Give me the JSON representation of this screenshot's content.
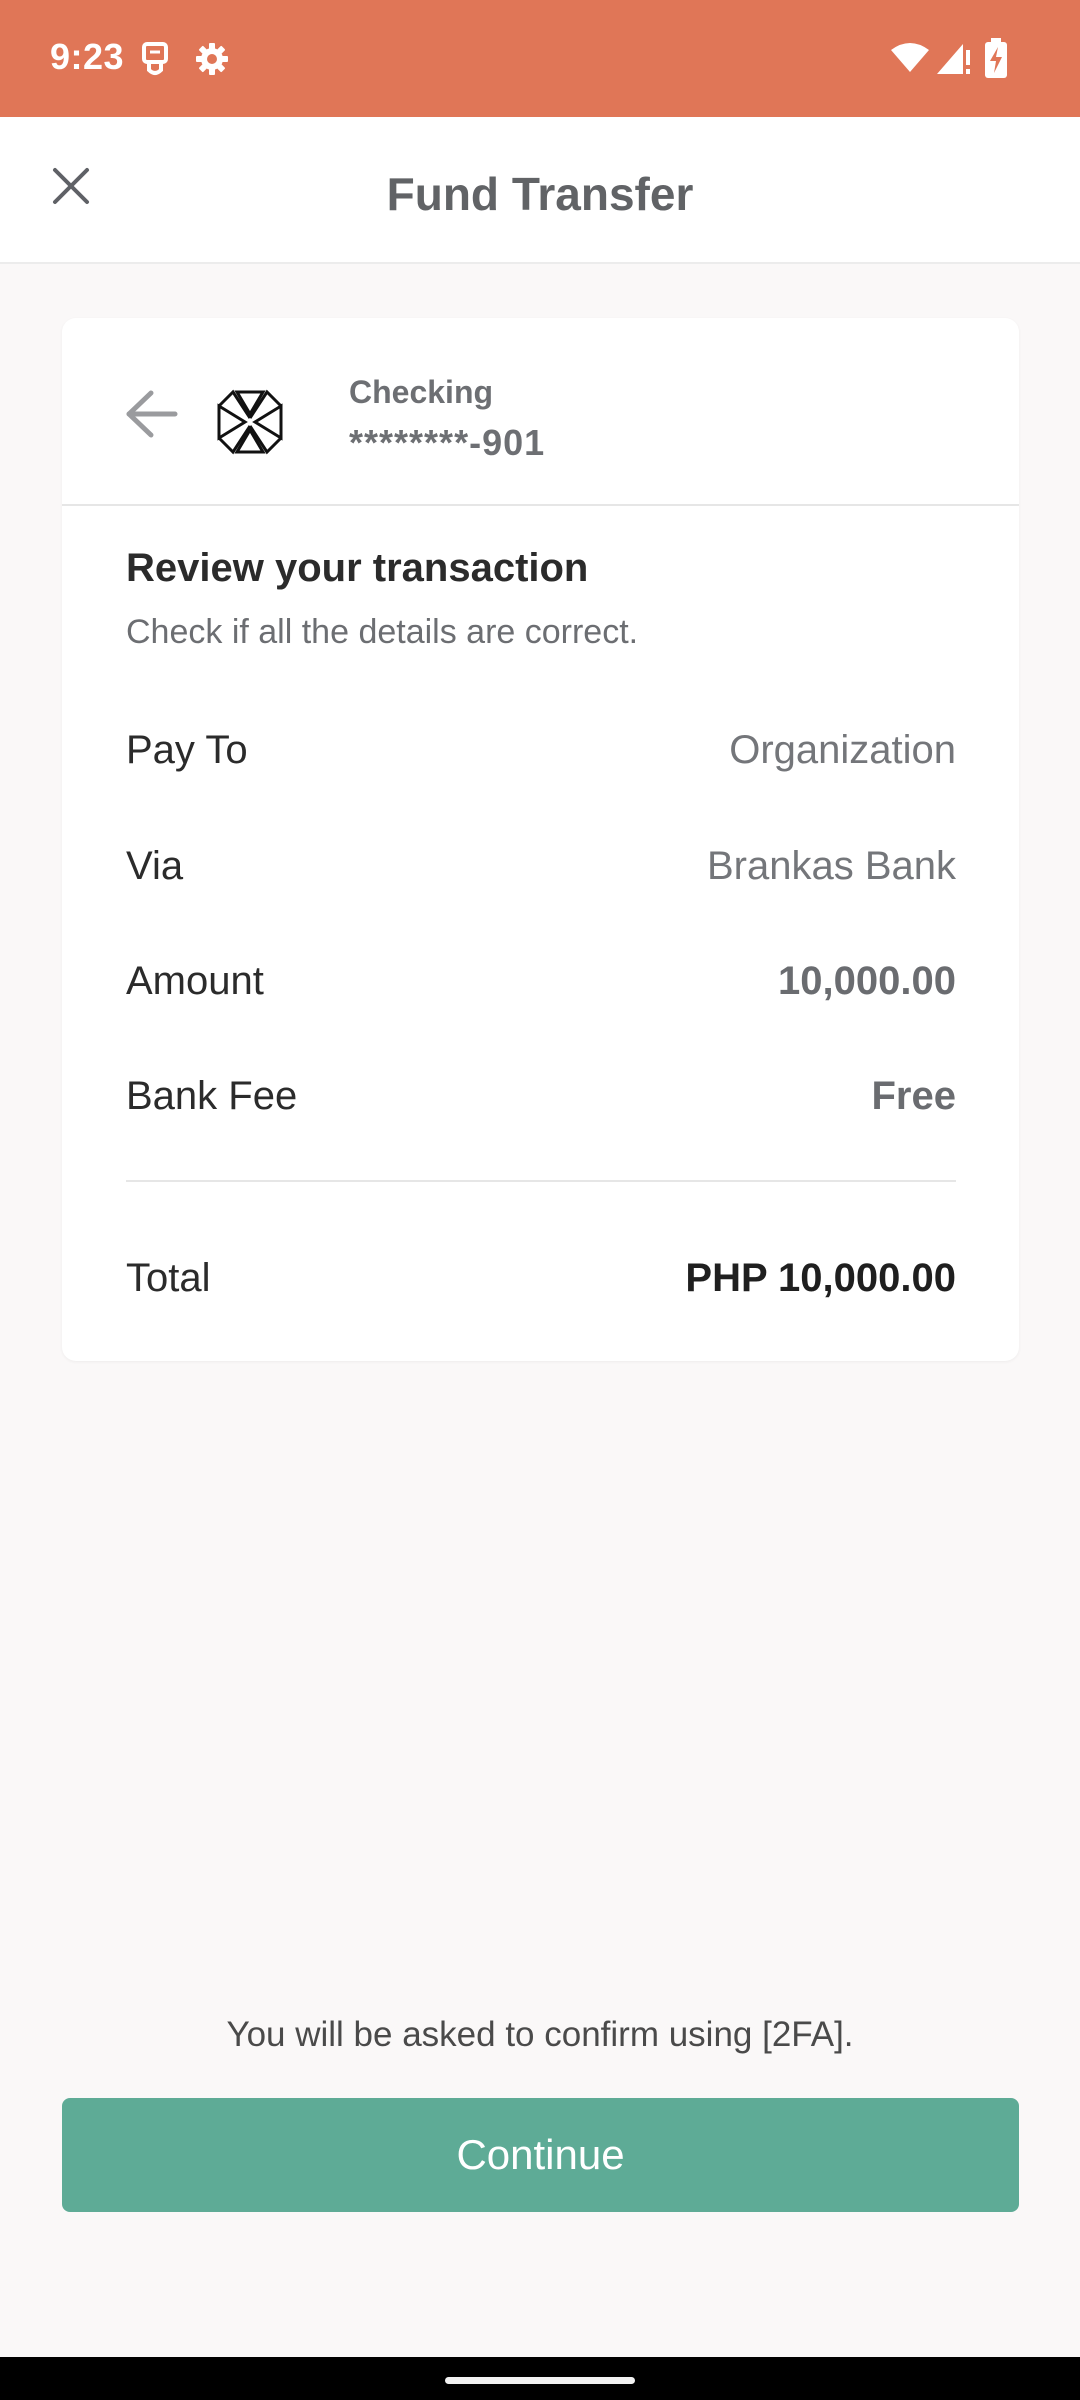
{
  "status_bar": {
    "time": "9:23",
    "icons": [
      "usb-icon",
      "gear-icon",
      "wifi-icon",
      "signal-icon",
      "battery-charging-icon"
    ],
    "background_color": "#e07657"
  },
  "header": {
    "title": "Fund Transfer",
    "close_icon": "close-icon"
  },
  "account": {
    "type": "Checking",
    "number": "********-901",
    "back_icon": "arrow-left-icon",
    "logo_icon": "bank-logo-icon"
  },
  "review": {
    "title": "Review your transaction",
    "subtitle": "Check if all the details are correct."
  },
  "details": [
    {
      "label": "Pay To",
      "value": "Organization"
    },
    {
      "label": "Via",
      "value": "Brankas Bank"
    },
    {
      "label": "Amount",
      "value": "10,000.00"
    },
    {
      "label": "Bank Fee",
      "value": "Free"
    }
  ],
  "total": {
    "label": "Total",
    "value": "PHP 10,000.00"
  },
  "footer": {
    "confirm_note": "You will be asked to confirm using [2FA].",
    "continue_label": "Continue",
    "button_color": "#5eab96"
  }
}
